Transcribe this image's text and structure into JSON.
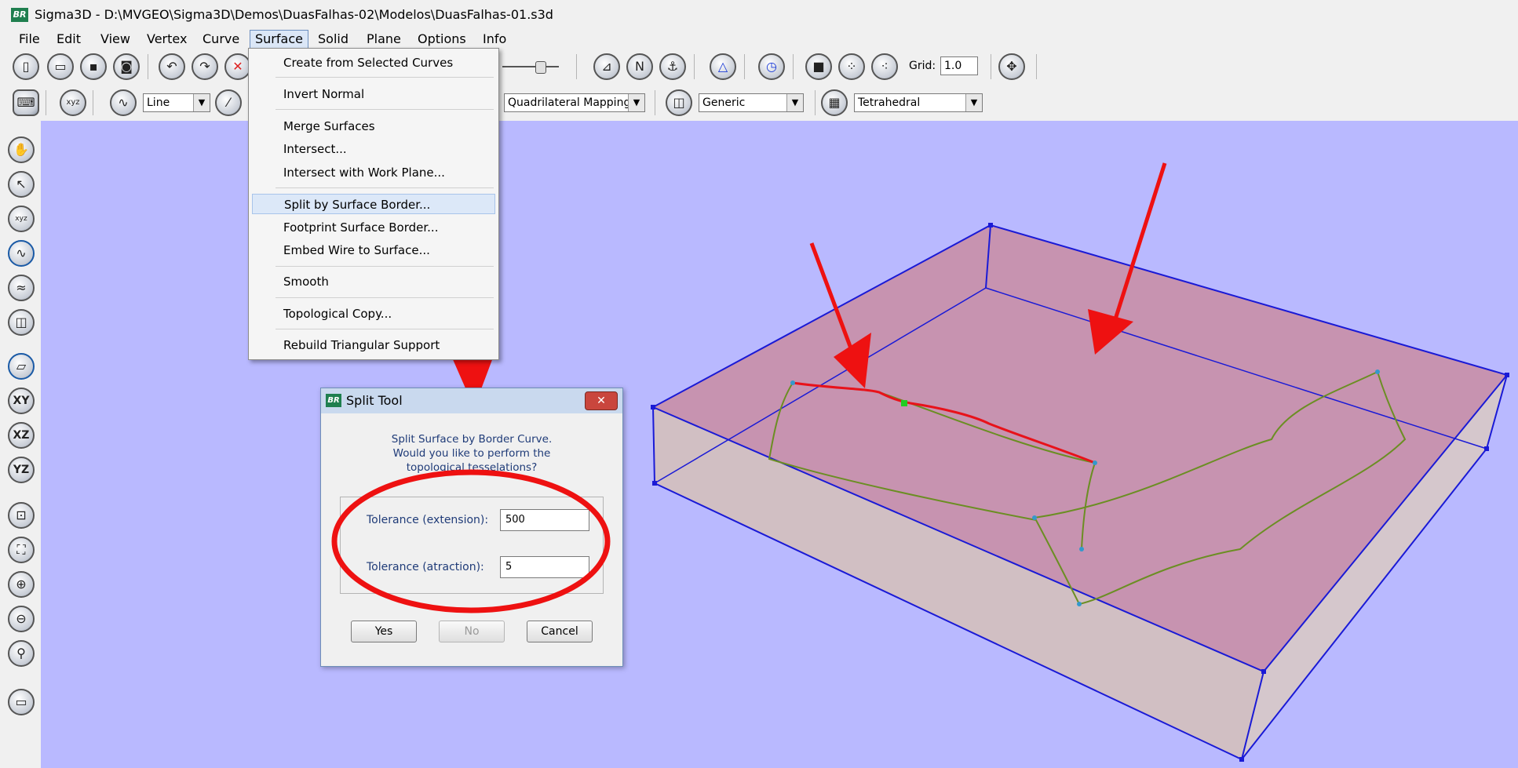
{
  "window": {
    "title": "Sigma3D - D:\\MVGEO\\Sigma3D\\Demos\\DuasFalhas-02\\Modelos\\DuasFalhas-01.s3d",
    "app_icon_text": "BR"
  },
  "menubar": {
    "items": [
      {
        "label": "File"
      },
      {
        "label": "Edit"
      },
      {
        "label": "View"
      },
      {
        "label": "Vertex"
      },
      {
        "label": "Curve"
      },
      {
        "label": "Surface"
      },
      {
        "label": "Solid"
      },
      {
        "label": "Plane"
      },
      {
        "label": "Options"
      },
      {
        "label": "Info"
      }
    ],
    "active": "Surface"
  },
  "surface_menu": {
    "items": [
      {
        "label": "Create from Selected Curves"
      },
      {
        "label": "Invert Normal"
      },
      {
        "label": "Merge Surfaces"
      },
      {
        "label": "Intersect..."
      },
      {
        "label": "Intersect with Work Plane..."
      },
      {
        "label": "Split by Surface Border..."
      },
      {
        "label": "Footprint Surface Border..."
      },
      {
        "label": "Embed Wire to Surface..."
      },
      {
        "label": "Smooth"
      },
      {
        "label": "Topological Copy..."
      },
      {
        "label": "Rebuild Triangular Support"
      }
    ],
    "highlighted": "Split by Surface Border..."
  },
  "toolbar": {
    "grid_label": "Grid:",
    "grid_value": "1.0",
    "curve_type": "Line",
    "mapping": "Quadrilateral Mapping",
    "material": "Generic",
    "mesh_type": "Tetrahedral",
    "sidebar_plane_labels": [
      "XY",
      "XZ",
      "YZ"
    ]
  },
  "split_dialog": {
    "title": "Split Tool",
    "icon_text": "BR",
    "message_lines": [
      "Split Surface by Border Curve.",
      "Would you like to perform the",
      "topological tesselations?"
    ],
    "tolerance_extension_label": "Tolerance (extension):",
    "tolerance_extension_value": "500",
    "tolerance_attraction_label": "Tolerance (atraction):",
    "tolerance_attraction_value": "5",
    "yes_label": "Yes",
    "no_label": "No",
    "cancel_label": "Cancel",
    "close_glyph": "✕"
  },
  "colors": {
    "viewport_background": "#b9b9ff",
    "annotation_red": "#ee1111",
    "box_edges": "#1a1ad6",
    "surface_fill": "#d4756f",
    "fault_curve": "#6b8e23"
  }
}
